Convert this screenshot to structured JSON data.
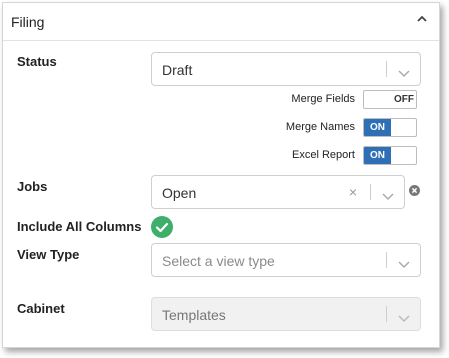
{
  "header": {
    "title": "Filing"
  },
  "status": {
    "label": "Status",
    "value": "Draft"
  },
  "toggles": [
    {
      "label": "Merge Fields",
      "state": "OFF"
    },
    {
      "label": "Merge Names",
      "state": "ON"
    },
    {
      "label": "Excel Report",
      "state": "ON"
    }
  ],
  "jobs": {
    "label": "Jobs",
    "value": "Open",
    "clear_glyph": "×"
  },
  "include_all_columns": {
    "label": "Include All Columns",
    "checked": true
  },
  "view_type": {
    "label": "View Type",
    "placeholder": "Select a view type"
  },
  "cabinet": {
    "label": "Cabinet",
    "value": "Templates",
    "disabled": true
  },
  "colors": {
    "accent": "#2f6fb6",
    "check": "#3fae6a",
    "remove": "#777777"
  }
}
